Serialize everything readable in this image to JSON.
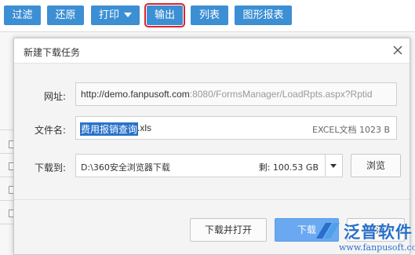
{
  "toolbar": {
    "buttons": [
      "过滤",
      "还原",
      "打印",
      "输出",
      "列表",
      "图形报表"
    ],
    "active": "输出",
    "accent": "#3d8fd4",
    "highlight": "#e0212c"
  },
  "dialog": {
    "title": "新建下载任务",
    "url_label": "网址:",
    "url_host": "http://demo.fanpusoft.com",
    "url_rest": ":8080/FormsManager/LoadRpts.aspx?Rptid",
    "filename_label": "文件名:",
    "filename_selected": "费用报销查询",
    "filename_ext": ".xls",
    "file_info": "EXCEL文档 1023 B",
    "saveto_label": "下载到:",
    "saveto_path": "D:\\360安全浏览器下载",
    "free_space": "剩: 100.53 GB",
    "browse_label": "浏览",
    "open_label": "下载并打开",
    "download_label": "下载",
    "cancel_label": "取消"
  },
  "watermark": {
    "brand": "泛普软件",
    "url": "www.fanpusoft.com"
  }
}
